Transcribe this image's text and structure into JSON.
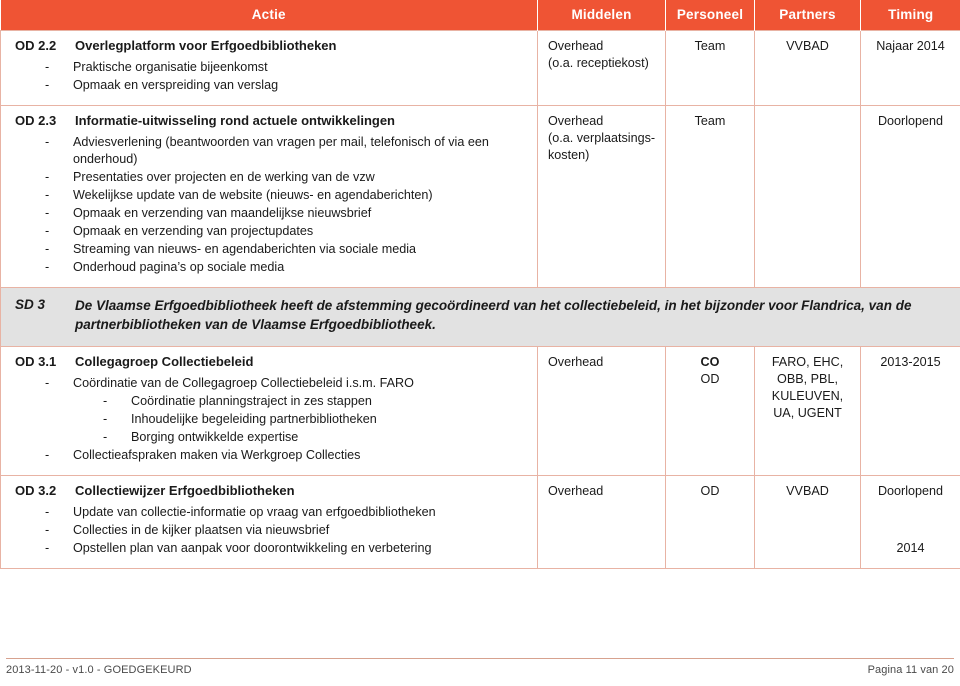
{
  "table": {
    "headers": {
      "actie": "Actie",
      "middelen": "Middelen",
      "personeel": "Personeel",
      "partners": "Partners",
      "timing": "Timing"
    },
    "header_bg": "#EF5434",
    "header_text_color": "#FFFFFF",
    "border_color": "#E8B3A4",
    "sd_row_bg": "#E2E2E2",
    "rows": [
      {
        "code": "OD 2.2",
        "title": "Overlegplatform voor Erfgoedbibliotheken",
        "bullets": [
          "Praktische organisatie bijeenkomst",
          "Opmaak en verspreiding van verslag"
        ],
        "middelen_line1": "Overhead",
        "middelen_line2": "(o.a. receptiekost)",
        "personeel": "Team",
        "partners": "VVBAD",
        "timing": "Najaar 2014"
      },
      {
        "code": "OD 2.3",
        "title": "Informatie-uitwisseling rond actuele ontwikkelingen",
        "bullets": [
          "Adviesverlening (beantwoorden van vragen per mail, telefonisch of via een onderhoud)",
          "Presentaties over projecten en de werking van de vzw",
          "Wekelijkse update van de website (nieuws- en agendaberichten)",
          "Opmaak en verzending van maandelijkse nieuwsbrief",
          "Opmaak en verzending van projectupdates",
          "Streaming van nieuws- en agendaberichten via sociale media",
          "Onderhoud pagina’s op sociale media"
        ],
        "middelen_line1": "Overhead",
        "middelen_line2": "(o.a. verplaatsings-kosten)",
        "personeel": "Team",
        "partners": "",
        "timing": "Doorlopend"
      }
    ],
    "sd_row": {
      "code": "SD 3",
      "text": "De Vlaamse Erfgoedbibliotheek heeft de afstemming gecoördineerd van het collectiebeleid, in het bijzonder voor Flandrica, van de partnerbibliotheken van de Vlaamse Erfgoedbibliotheek."
    },
    "rows2": [
      {
        "code": "OD 3.1",
        "title": "Collegagroep Collectiebeleid",
        "bullet1": "Coördinatie van de Collegagroep Collectiebeleid i.s.m. FARO",
        "subbullets": [
          "Coördinatie planningstraject in zes stappen",
          "Inhoudelijke begeleiding partnerbibliotheken",
          "Borging ontwikkelde expertise"
        ],
        "bullet2": "Collectieafspraken maken via Werkgroep Collecties",
        "middelen": "Overhead",
        "personeel_bold": "CO",
        "personeel_plain": "OD",
        "partners": "FARO, EHC,\nOBB, PBL,\nKULEUVEN,\nUA, UGENT",
        "timing": "2013-2015"
      },
      {
        "code": "OD 3.2",
        "title": "Collectiewijzer Erfgoedbibliotheken",
        "bullets": [
          "Update van collectie-informatie op vraag van erfgoedbibliotheken",
          "Collecties in de kijker plaatsen via nieuwsbrief",
          "Opstellen plan van aanpak voor doorontwikkeling en verbetering"
        ],
        "middelen": "Overhead",
        "personeel": "OD",
        "partners": "VVBAD",
        "timing_line1": "Doorlopend",
        "timing_line2": "2014"
      }
    ]
  },
  "footer": {
    "left": "2013-11-20 - v1.0 - GOEDGEKEURD",
    "right": "Pagina 11 van 20"
  }
}
